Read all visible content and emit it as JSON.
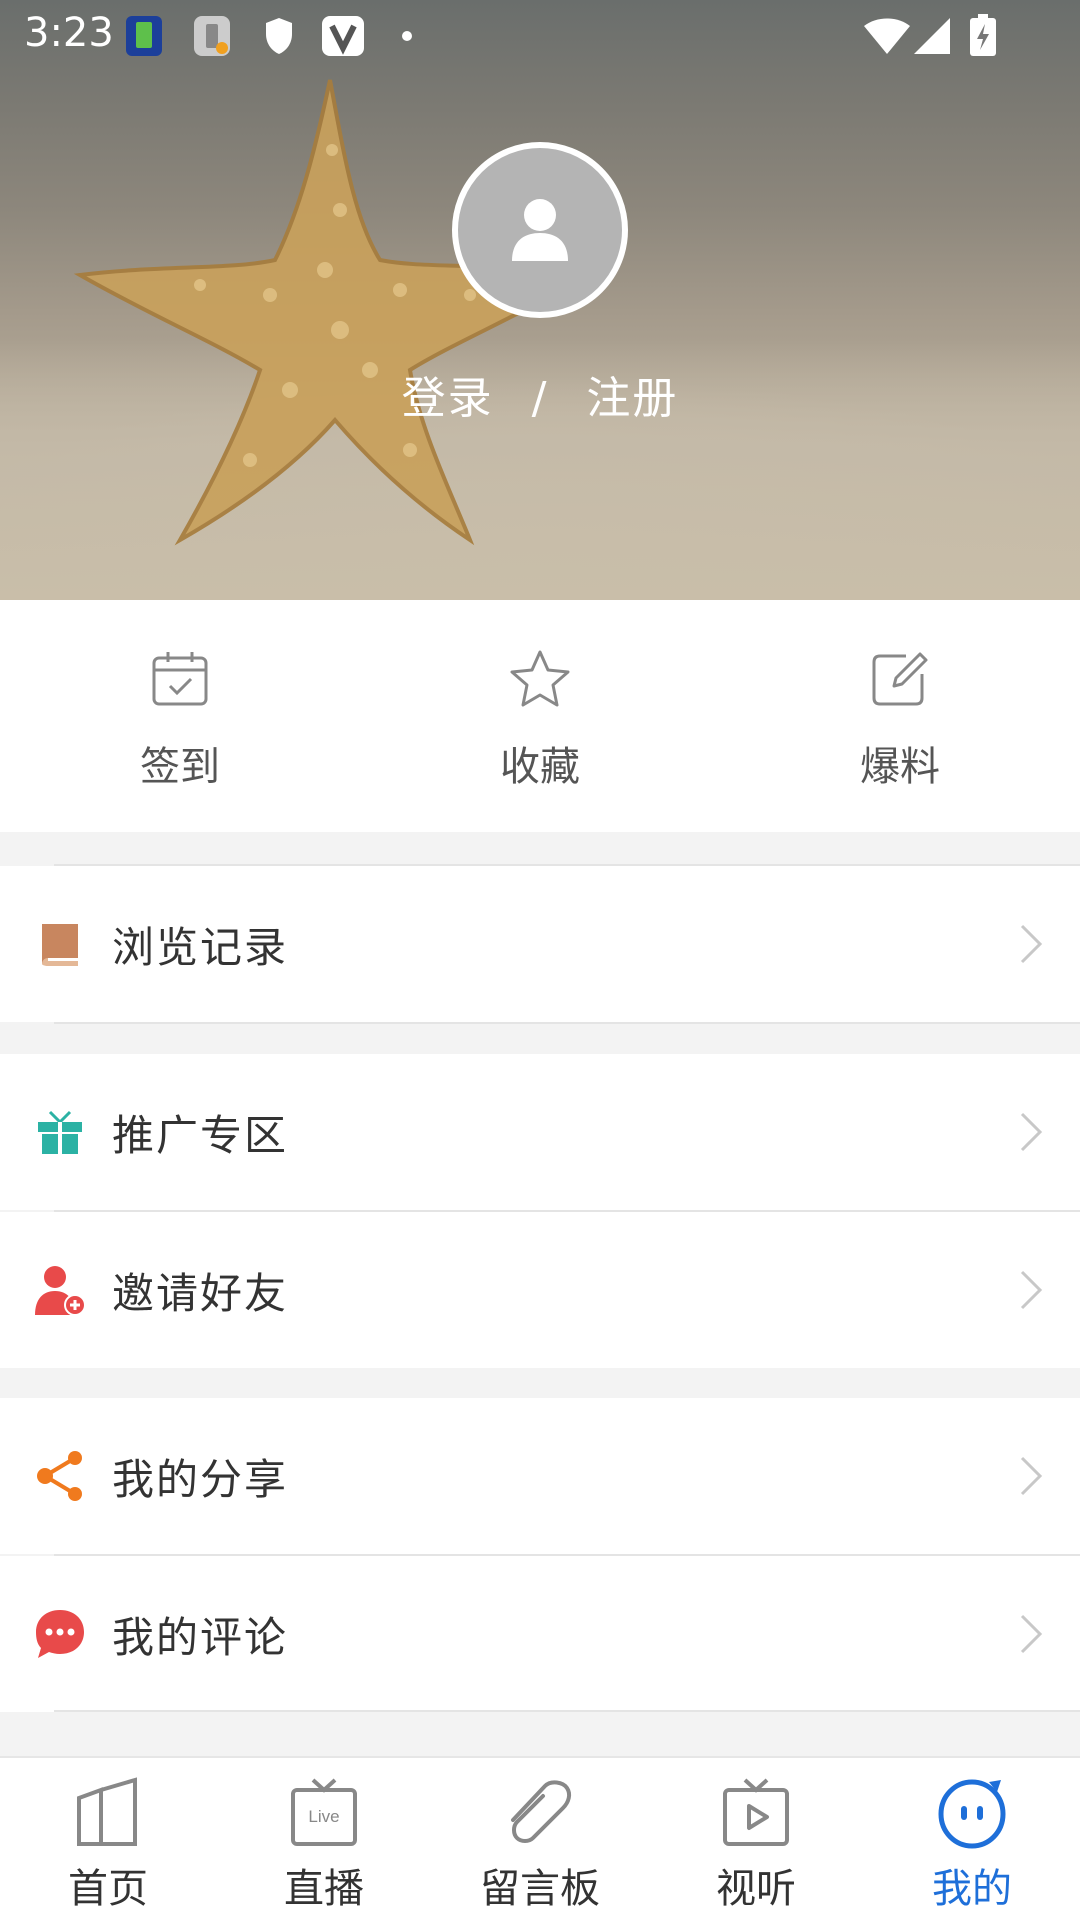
{
  "status_bar": {
    "time": "3:23"
  },
  "profile": {
    "login_label": "登录",
    "separator": "/",
    "register_label": "注册"
  },
  "quick_actions": [
    {
      "label": "签到",
      "icon": "calendar-check-icon"
    },
    {
      "label": "收藏",
      "icon": "star-icon"
    },
    {
      "label": "爆料",
      "icon": "edit-icon"
    }
  ],
  "menu": [
    {
      "label": "浏览记录",
      "icon": "book-icon",
      "color": "#c8865f"
    },
    {
      "label": "推广专区",
      "icon": "gift-icon",
      "color": "#2bb2a4"
    },
    {
      "label": "邀请好友",
      "icon": "add-user-icon",
      "color": "#e84a4a"
    },
    {
      "label": "我的分享",
      "icon": "share-icon",
      "color": "#f07a1e"
    },
    {
      "label": "我的评论",
      "icon": "comment-icon",
      "color": "#e84a4a"
    }
  ],
  "tabs": [
    {
      "label": "首页",
      "icon": "home-icon",
      "active": false
    },
    {
      "label": "直播",
      "icon": "live-tv-icon",
      "active": false
    },
    {
      "label": "留言板",
      "icon": "message-board-icon",
      "active": false
    },
    {
      "label": "视听",
      "icon": "video-play-icon",
      "active": false
    },
    {
      "label": "我的",
      "icon": "me-face-icon",
      "active": true
    }
  ],
  "colors": {
    "active_tab": "#1e6fd9"
  }
}
